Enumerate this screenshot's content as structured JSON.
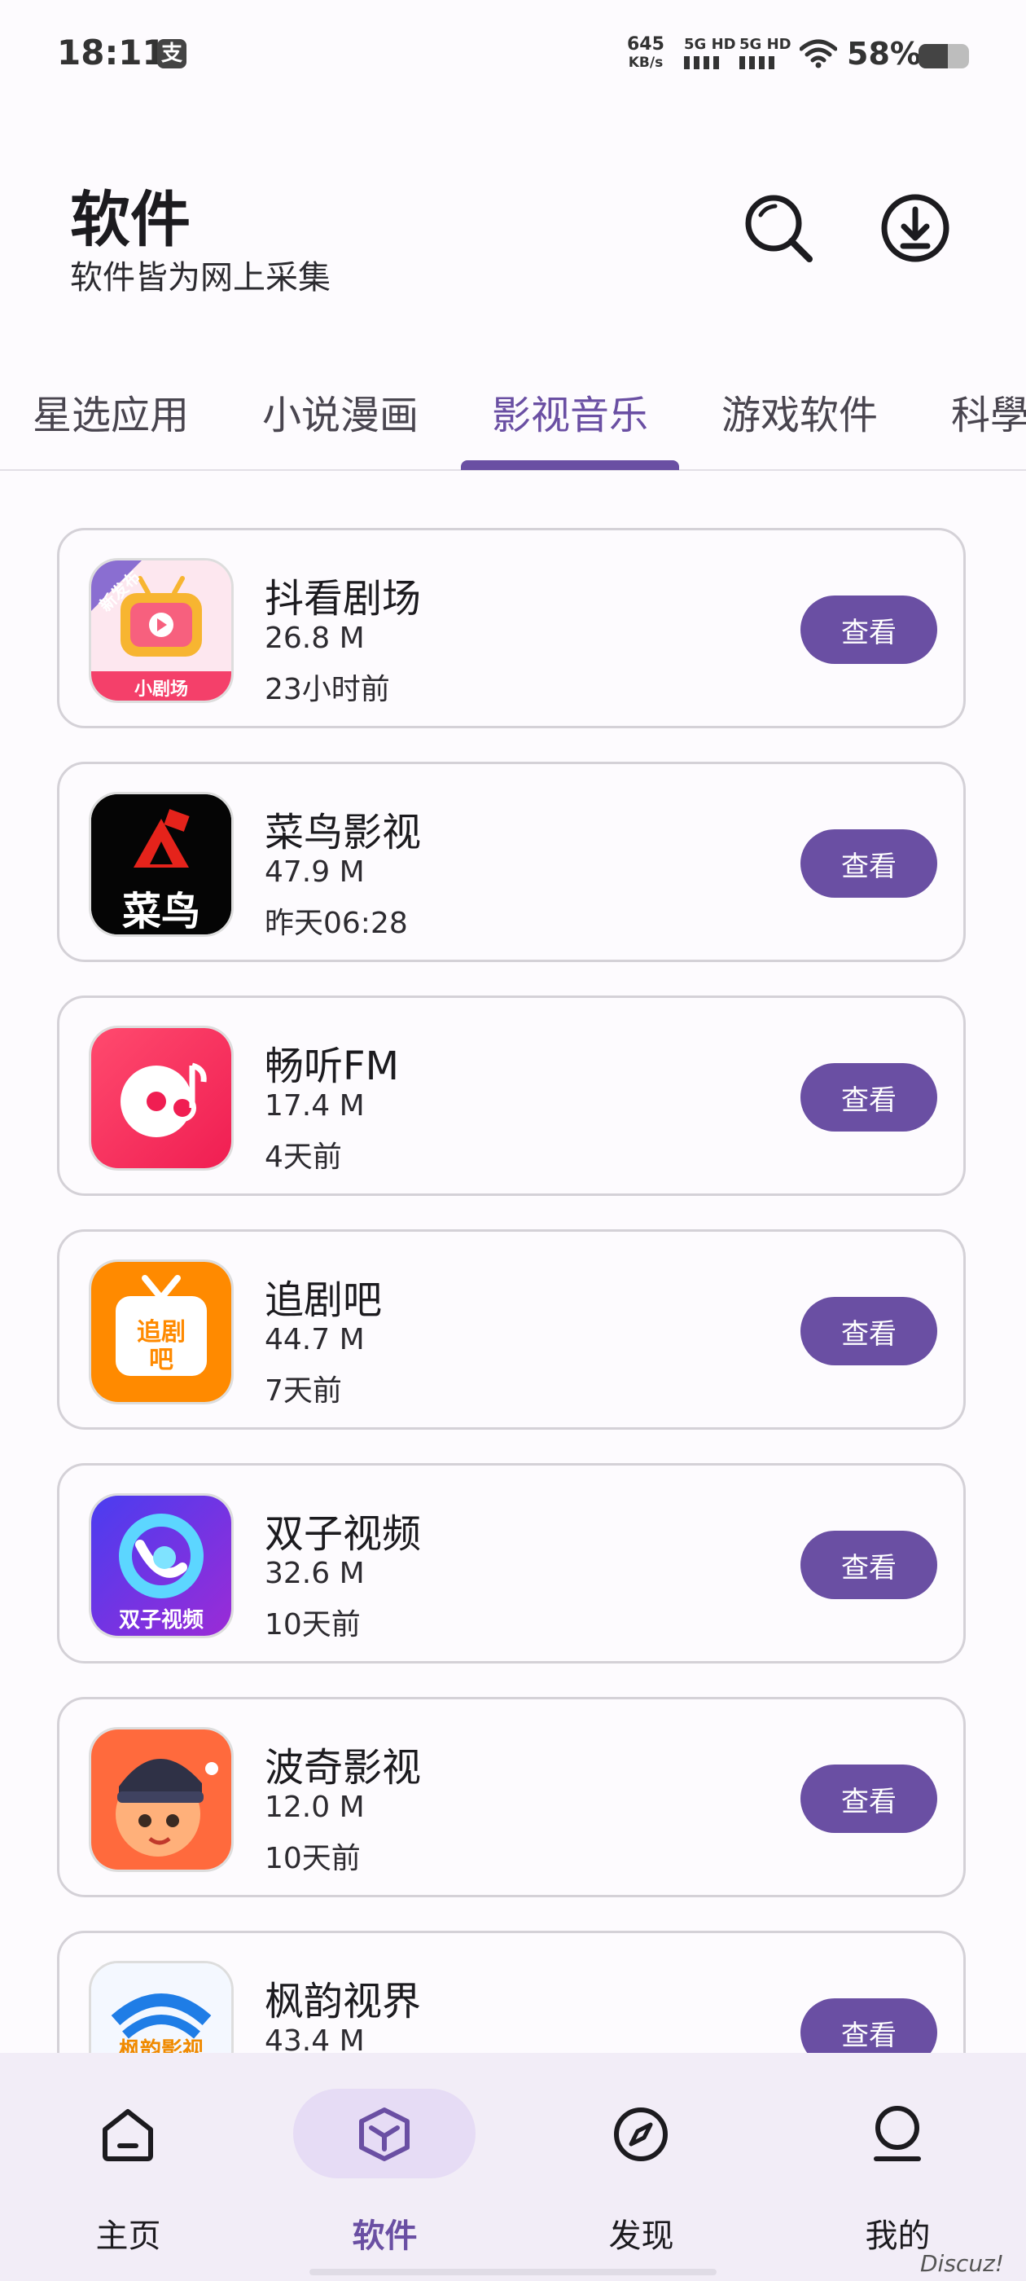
{
  "status_bar": {
    "time": "18:11",
    "pay_badge": "支",
    "net_speed_value": "645",
    "net_speed_unit": "KB/s",
    "sim1": "5G HD",
    "sim2": "5G HD",
    "battery_percent": "58%"
  },
  "header": {
    "title": "软件",
    "subtitle": "软件皆为网上采集",
    "search_icon": "search-icon",
    "download_icon": "download-icon"
  },
  "tabs": [
    {
      "label": "星选应用"
    },
    {
      "label": "小说漫画"
    },
    {
      "label": "影视音乐"
    },
    {
      "label": "游戏软件"
    },
    {
      "label": "科學"
    }
  ],
  "active_tab": "影视音乐",
  "apps": [
    {
      "name": "抖看剧场",
      "size": "26.8 M",
      "time": "23小时前",
      "button": "查看",
      "icon_badge": "新发布",
      "icon_text": "小剧场"
    },
    {
      "name": "菜鸟影视",
      "size": "47.9 M",
      "time": "昨天06:28",
      "button": "查看",
      "icon_text": "菜鸟"
    },
    {
      "name": "畅听FM",
      "size": "17.4 M",
      "time": "4天前",
      "button": "查看"
    },
    {
      "name": "追剧吧",
      "size": "44.7 M",
      "time": "7天前",
      "button": "查看",
      "icon_text": "追剧吧"
    },
    {
      "name": "双子视频",
      "size": "32.6 M",
      "time": "10天前",
      "button": "查看",
      "icon_text": "双子视频"
    },
    {
      "name": "波奇影视",
      "size": "12.0 M",
      "time": "10天前",
      "button": "查看"
    },
    {
      "name": "枫韵视界",
      "size": "43.4 M",
      "time": "",
      "button": "查看",
      "icon_text": "枫韵影视"
    }
  ],
  "bottom_nav": [
    {
      "label": "主页",
      "icon": "home-icon"
    },
    {
      "label": "软件",
      "icon": "cube-icon"
    },
    {
      "label": "发现",
      "icon": "compass-icon"
    },
    {
      "label": "我的",
      "icon": "person-icon"
    }
  ],
  "watermark": "Discuz!",
  "colors": {
    "accent": "#6a4fa3",
    "background": "#fdfbfe",
    "nav_bg": "#f2edf7"
  }
}
